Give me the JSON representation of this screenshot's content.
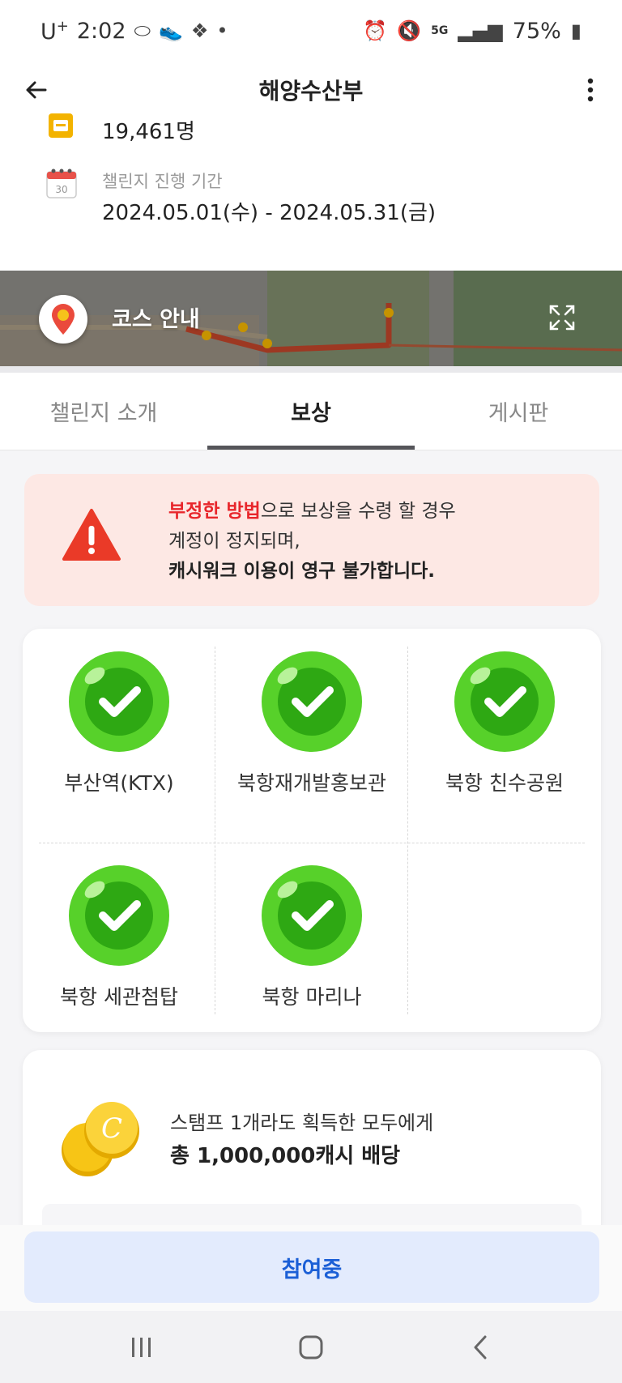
{
  "status_bar": {
    "carrier": "U",
    "carrier_sup": "+",
    "time": "2:02",
    "network": "5G",
    "battery": "75%"
  },
  "header": {
    "title": "해양수산부"
  },
  "info": {
    "participants_value": "19,461명",
    "period_label": "챌린지 진행 기간",
    "period_value": "2024.05.01(수) - 2024.05.31(금)",
    "calendar_day": "30"
  },
  "map": {
    "title": "코스 안내"
  },
  "tabs": [
    {
      "label": "챌린지 소개",
      "active": false
    },
    {
      "label": "보상",
      "active": true
    },
    {
      "label": "게시판",
      "active": false
    }
  ],
  "warning": {
    "red_text": "부정한 방법",
    "line1_rest": "으로 보상을 수령 할 경우",
    "line2": "계정이 정지되며,",
    "line3": "캐시워크 이용이 영구 불가합니다."
  },
  "stamps": [
    {
      "label": "부산역(KTX)",
      "completed": true
    },
    {
      "label": "북항재개발홍보관",
      "completed": true
    },
    {
      "label": "북항 친수공원",
      "completed": true
    },
    {
      "label": "북항 세관첨탑",
      "completed": true
    },
    {
      "label": "북항 마리나",
      "completed": true
    }
  ],
  "reward": {
    "line1": "스탬프 1개라도 획득한 모두에게",
    "line2": "총 1,000,000캐시 배당",
    "coin_letter": "C"
  },
  "join_button": {
    "label": "참여중"
  },
  "colors": {
    "accent_blue": "#1b5fd6",
    "warning_red": "#e8262b",
    "stamp_green": "#3dbb1a"
  }
}
